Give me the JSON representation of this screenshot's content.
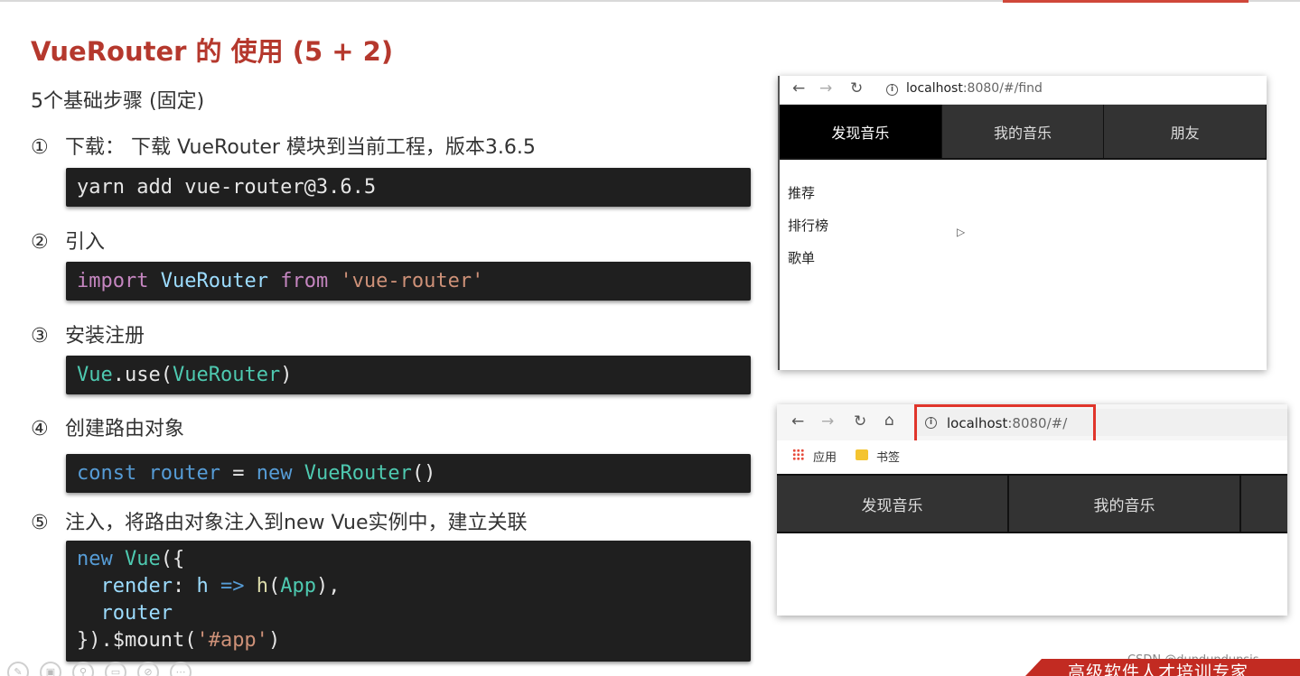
{
  "slide": {
    "title": "VueRouter 的 使用 (5 + 2)",
    "subtitle": "5个基础步骤 (固定)",
    "steps": [
      {
        "num": "①",
        "text": "下载： 下载 VueRouter 模块到当前工程，版本3.6.5"
      },
      {
        "num": "②",
        "text": "引入"
      },
      {
        "num": "③",
        "text": "安装注册"
      },
      {
        "num": "④",
        "text": "创建路由对象"
      },
      {
        "num": "⑤",
        "text": "注入，将路由对象注入到new Vue实例中，建立关联"
      }
    ],
    "code": {
      "yarn": "yarn add vue-router@3.6.5",
      "import": {
        "kw": "import",
        "name": "VueRouter",
        "from": "from",
        "str": "'vue-router'"
      },
      "use": {
        "obj": "Vue",
        "dot_method": ".use(",
        "arg": "VueRouter",
        "close": ")"
      },
      "create": {
        "kw": "const",
        "var": "router",
        "eq": " = ",
        "new": "new",
        "cls": "VueRouter",
        "paren": "()"
      },
      "inject": {
        "line1_new": "new",
        "line1_vue": "Vue",
        "line1_rest": "({",
        "line2_key": "render",
        "line2_colon": ": ",
        "line2_h": "h",
        "line2_arrow": "=>",
        "line2_fn": "h",
        "line2_app": "App",
        "line2_end": "),",
        "line3": "router",
        "line4_start": "}).$mount(",
        "line4_str": "'#app'",
        "line4_end": ")"
      }
    }
  },
  "browser1": {
    "url_host": "localhost",
    "url_rest": ":8080/#/find",
    "tabs": [
      "发现音乐",
      "我的音乐",
      "朋友"
    ],
    "active_tab": 0,
    "sub_items": [
      "推荐",
      "排行榜",
      "歌单"
    ]
  },
  "browser2": {
    "url_host": "localhost",
    "url_rest": ":8080/#/",
    "bookmarks": [
      "应用",
      "书签"
    ],
    "tabs": [
      "发现音乐",
      "我的音乐"
    ],
    "highlight_color": "#e0352b"
  },
  "footer": {
    "watermark": "CSDN @dundundunsis",
    "banner": "高级软件人才培训专家"
  },
  "colors": {
    "accent": "#b5382d",
    "code_bg": "#1f1f1f"
  }
}
